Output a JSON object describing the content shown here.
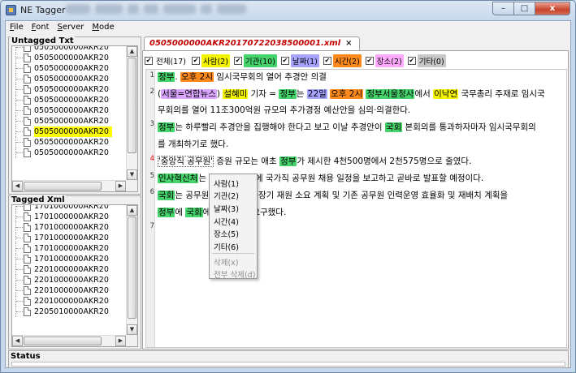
{
  "window": {
    "title": "NE Tagger",
    "close_glyph": "x",
    "min_glyph": "–",
    "max_glyph": "□"
  },
  "menu": [
    {
      "label": "File",
      "mnemonic": "F",
      "rest": "ile"
    },
    {
      "label": "Font",
      "mnemonic": "F",
      "rest": "ont"
    },
    {
      "label": "Server",
      "mnemonic": "S",
      "rest": "erver"
    },
    {
      "label": "Mode",
      "mnemonic": "M",
      "rest": "ode"
    }
  ],
  "untagged": {
    "title": "Untagged Txt",
    "items": [
      "0505000000AKR20",
      "0505000000AKR20",
      "0505000000AKR20",
      "0505000000AKR20",
      "0505000000AKR20",
      "0505000000AKR20",
      "0505000000AKR20",
      "0505000000AKR20",
      "0505000000AKR20",
      "0505000000AKR20",
      "0505000000AKR20"
    ],
    "selected_index": 8
  },
  "tagged": {
    "title": "Tagged Xml",
    "items": [
      "1701000000AKR20",
      "1701000000AKR20",
      "1701000000AKR20",
      "1701000000AKR20",
      "1701000000AKR20",
      "1701000000AKR20",
      "2201000000AKR20",
      "2201000000AKR20",
      "2201000000AKR20",
      "2201000000AKR20",
      "2205010000AKR20"
    ]
  },
  "tab": {
    "title": "0505000000AKR20170722038500001.xml",
    "close": "×"
  },
  "filters": [
    {
      "label": "전체(17)",
      "color": "#ffffff",
      "checked": true
    },
    {
      "label": "사람(2)",
      "color": "#f4f400",
      "checked": true
    },
    {
      "label": "기관(10)",
      "color": "#45d36b",
      "checked": true
    },
    {
      "label": "날짜(1)",
      "color": "#a7a4ff",
      "checked": true
    },
    {
      "label": "시간(2)",
      "color": "#ff8a1c",
      "checked": true
    },
    {
      "label": "장소(2)",
      "color": "#ffaaff",
      "checked": true
    },
    {
      "label": "기타(0)",
      "color": "#c8c8c8",
      "checked": true
    }
  ],
  "line_numbers": [
    "1",
    "2",
    "3",
    "4",
    "5",
    "6",
    "7"
  ],
  "doc": {
    "l1": {
      "t1": "정부",
      "t2": ". ",
      "t3": "오후 2시",
      "t4": " 임시국무회의 열어 추경안 의결"
    },
    "l2a": {
      "t1": "(",
      "t2": "서울=연합뉴스",
      "t3": ") ",
      "t4": "설혜미",
      "t5": " 기자 = ",
      "t6": "정부",
      "t7": "는 ",
      "t8": "22일",
      "t9": " ",
      "t10": "오후 2시",
      "t11": " ",
      "t12": "정부서울청사",
      "t13": "에서 ",
      "t14": "이낙연",
      "t15": " 국무총리 주재로 임시국"
    },
    "l2b": "무회의를 열어 11조300억원 규모의 추가경정 예산안을 심의·의결한다.",
    "l3a": {
      "t1": "정부",
      "t2": "는 하루빨리 추경안을 집행해야 한다고 보고 이날 추경안이 ",
      "t3": "국회",
      "t4": " 본회의를 통과하자마자 임시국무회의"
    },
    "l3b": "를 개최하기로 했다.",
    "l4": {
      "t1": "'중앙직 공무원'",
      "t2": " 증원 규모는 애초 ",
      "t3": "정부",
      "t4": "가 제시한 4천500명에서 2천575명으로 줄였다."
    },
    "l5": {
      "t1": "인사혁신처",
      "t2": "는",
      "t3": "에 국가직 공무원 채용 일정을 보고하고 곧바로 발표할 예정이다."
    },
    "l6a": {
      "t1": "국회",
      "t2": "는 공무원",
      "t3": "른 중장기 재원 소요 계획 및 기존 공무원 인력운영 효율화 및 재배치 계획을"
    },
    "l6b": {
      "t1": "정부",
      "t2": "에 ",
      "t3": "국회",
      "t4": "에",
      "t5": "을 요구했다."
    }
  },
  "context_menu": {
    "items": [
      "사람(1)",
      "기관(2)",
      "날짜(3)",
      "시간(4)",
      "장소(5)",
      "기타(6)"
    ],
    "disabled": [
      "삭제(x)",
      "전부 삭제(d)"
    ]
  },
  "status": {
    "title": "Status"
  }
}
